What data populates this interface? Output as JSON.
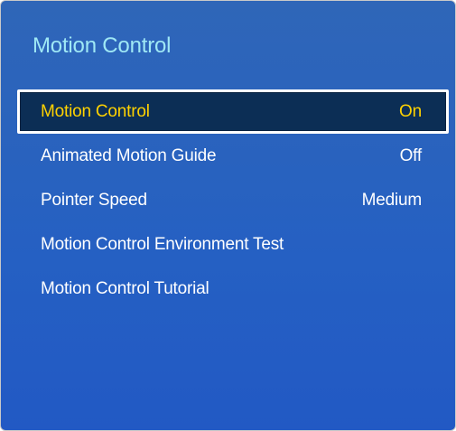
{
  "panel": {
    "title": "Motion Control"
  },
  "menu": {
    "items": [
      {
        "label": "Motion Control",
        "value": "On",
        "selected": true
      },
      {
        "label": "Animated Motion Guide",
        "value": "Off"
      },
      {
        "label": "Pointer Speed",
        "value": "Medium"
      },
      {
        "label": "Motion Control Environment Test",
        "value": ""
      },
      {
        "label": "Motion Control Tutorial",
        "value": ""
      }
    ]
  },
  "colors": {
    "background": "#2560c3",
    "title": "#9fe8f5",
    "selected_text": "#ffd200",
    "selected_bg": "#0c2e55",
    "text": "#ffffff"
  }
}
